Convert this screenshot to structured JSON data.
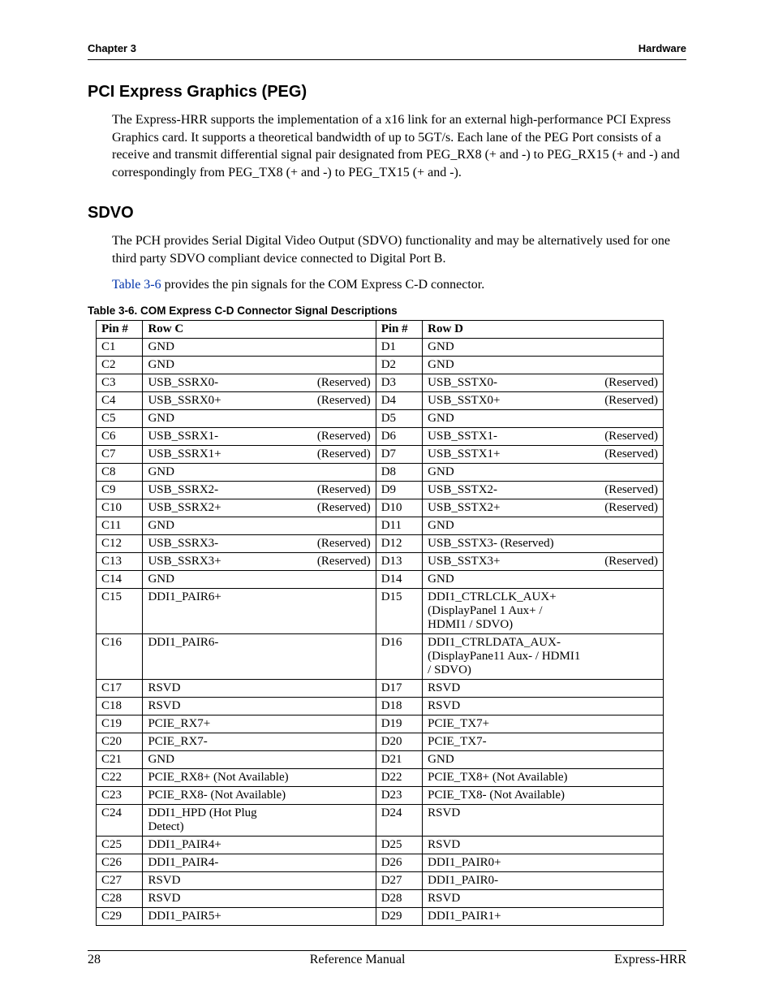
{
  "header": {
    "left": "Chapter 3",
    "right": "Hardware"
  },
  "sec1": {
    "title": "PCI Express Graphics (PEG)",
    "para": "The Express-HRR supports the implementation of a x16 link for an external high-performance PCI Express Graphics card. It supports a theoretical bandwidth of up to 5GT/s. Each lane of the PEG Port consists of a receive and transmit differential signal pair designated from PEG_RX8 (+ and -) to PEG_RX15 (+ and -) and correspondingly from PEG_TX8 (+ and -) to PEG_TX15 (+ and -)."
  },
  "sec2": {
    "title": "SDVO",
    "para1": "The PCH provides Serial Digital Video Output (SDVO) functionality and may be alternatively used for one third party SDVO compliant device connected to Digital Port B.",
    "para2_pre": "",
    "xref": "Table 3-6",
    "para2_post": " provides the pin signals for the COM Express C-D connector."
  },
  "table": {
    "caption": "Table 3-6.   COM Express C-D Connector Signal Descriptions",
    "head": {
      "pinC": "Pin #",
      "rowC": "Row C",
      "pinD": "Pin #",
      "rowD": "Row D"
    },
    "rows": [
      {
        "c": "C1",
        "cs": "GND",
        "cr": "",
        "d": "D1",
        "ds": "GND",
        "dr": ""
      },
      {
        "c": "C2",
        "cs": "GND",
        "cr": "",
        "d": "D2",
        "ds": "GND",
        "dr": ""
      },
      {
        "c": "C3",
        "cs": "USB_SSRX0-",
        "cr": "(Reserved)",
        "d": "D3",
        "ds": "USB_SSTX0-",
        "dr": "(Reserved)"
      },
      {
        "c": "C4",
        "cs": "USB_SSRX0+",
        "cr": "(Reserved)",
        "d": "D4",
        "ds": "USB_SSTX0+",
        "dr": "(Reserved)"
      },
      {
        "c": "C5",
        "cs": "GND",
        "cr": "",
        "d": "D5",
        "ds": "GND",
        "dr": ""
      },
      {
        "c": "C6",
        "cs": "USB_SSRX1-",
        "cr": "(Reserved)",
        "d": "D6",
        "ds": "USB_SSTX1-",
        "dr": "(Reserved)"
      },
      {
        "c": "C7",
        "cs": "USB_SSRX1+",
        "cr": "(Reserved)",
        "d": "D7",
        "ds": "USB_SSTX1+",
        "dr": "(Reserved)"
      },
      {
        "c": "C8",
        "cs": "GND",
        "cr": "",
        "d": "D8",
        "ds": "GND",
        "dr": ""
      },
      {
        "c": "C9",
        "cs": "USB_SSRX2-",
        "cr": "(Reserved)",
        "d": "D9",
        "ds": "USB_SSTX2-",
        "dr": "(Reserved)"
      },
      {
        "c": "C10",
        "cs": "USB_SSRX2+",
        "cr": "(Reserved)",
        "d": "D10",
        "ds": "USB_SSTX2+",
        "dr": "(Reserved)"
      },
      {
        "c": "C11",
        "cs": "GND",
        "cr": "",
        "d": "D11",
        "ds": "GND",
        "dr": ""
      },
      {
        "c": "C12",
        "cs": "USB_SSRX3-",
        "cr": "(Reserved)",
        "d": "D12",
        "ds": "USB_SSTX3- (Reserved)",
        "dr": ""
      },
      {
        "c": "C13",
        "cs": "USB_SSRX3+",
        "cr": "(Reserved)",
        "d": "D13",
        "ds": "USB_SSTX3+",
        "dr": "(Reserved)"
      },
      {
        "c": "C14",
        "cs": "GND",
        "cr": "",
        "d": "D14",
        "ds": "GND",
        "dr": ""
      },
      {
        "c": "C15",
        "cs": "DDI1_PAIR6+",
        "cr": "",
        "d": "D15",
        "ds": "DDI1_CTRLCLK_AUX+\n(DisplayPanel 1 Aux+ / HDMI1 / SDVO)",
        "dr": ""
      },
      {
        "c": "C16",
        "cs": "DDI1_PAIR6-",
        "cr": "",
        "d": "D16",
        "ds": "DDI1_CTRLDATA_AUX-\n(DisplayPane11 Aux- / HDMI1 / SDVO)",
        "dr": ""
      },
      {
        "c": "C17",
        "cs": "RSVD",
        "cr": "",
        "d": "D17",
        "ds": "RSVD",
        "dr": ""
      },
      {
        "c": "C18",
        "cs": "RSVD",
        "cr": "",
        "d": "D18",
        "ds": "RSVD",
        "dr": ""
      },
      {
        "c": "C19",
        "cs": "PCIE_RX7+",
        "cr": "",
        "d": "D19",
        "ds": "PCIE_TX7+",
        "dr": ""
      },
      {
        "c": "C20",
        "cs": "PCIE_RX7-",
        "cr": "",
        "d": "D20",
        "ds": "PCIE_TX7-",
        "dr": ""
      },
      {
        "c": "C21",
        "cs": "GND",
        "cr": "",
        "d": "D21",
        "ds": "GND",
        "dr": ""
      },
      {
        "c": "C22",
        "cs": "PCIE_RX8+ (Not Available)",
        "cr": "",
        "d": "D22",
        "ds": "PCIE_TX8+ (Not Available)",
        "dr": ""
      },
      {
        "c": "C23",
        "cs": "PCIE_RX8- (Not Available)",
        "cr": "",
        "d": "D23",
        "ds": "PCIE_TX8- (Not Available)",
        "dr": ""
      },
      {
        "c": "C24",
        "cs": "DDI1_HPD (Hot Plug Detect)",
        "cr": "",
        "d": "D24",
        "ds": "RSVD",
        "dr": ""
      },
      {
        "c": "C25",
        "cs": "DDI1_PAIR4+",
        "cr": "",
        "d": "D25",
        "ds": "RSVD",
        "dr": ""
      },
      {
        "c": "C26",
        "cs": "DDI1_PAIR4-",
        "cr": "",
        "d": "D26",
        "ds": "DDI1_PAIR0+",
        "dr": ""
      },
      {
        "c": "C27",
        "cs": "RSVD",
        "cr": "",
        "d": "D27",
        "ds": "DDI1_PAIR0-",
        "dr": ""
      },
      {
        "c": "C28",
        "cs": "RSVD",
        "cr": "",
        "d": "D28",
        "ds": "RSVD",
        "dr": ""
      },
      {
        "c": "C29",
        "cs": "DDI1_PAIR5+",
        "cr": "",
        "d": "D29",
        "ds": "DDI1_PAIR1+",
        "dr": ""
      }
    ]
  },
  "footer": {
    "left": "28",
    "center": "Reference Manual",
    "right": "Express-HRR"
  }
}
